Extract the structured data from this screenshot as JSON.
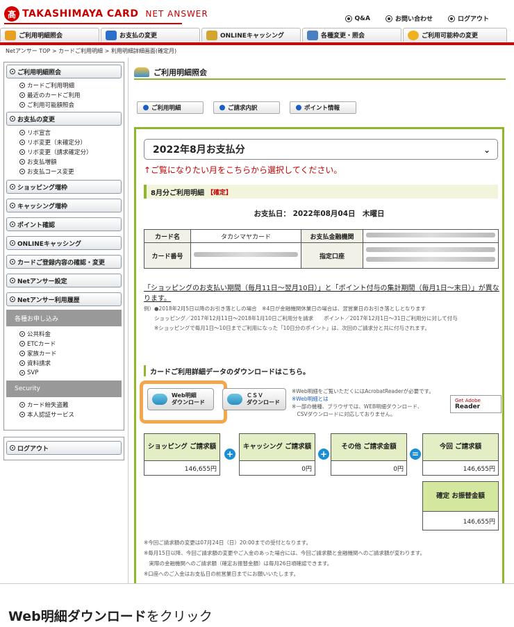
{
  "header": {
    "logo_mark": "髙",
    "logo_text": "TAKASHIMAYA CARD",
    "logo_sub": "NET ANSWER",
    "links": [
      "Q&A",
      "お問い合わせ",
      "ログアウト"
    ]
  },
  "tabs": [
    {
      "label": "ご利用明細照会",
      "color": "#e8a020"
    },
    {
      "label": "お支払の変更",
      "color": "#2c6fc8"
    },
    {
      "label": "ONLINEキャッシング",
      "color": "#d4a52e"
    },
    {
      "label": "各種変更・照会",
      "color": "#4a7fc0"
    },
    {
      "label": "ご利用可能枠の変更",
      "color": "#f0b020"
    }
  ],
  "breadcrumb": "Netアンサー TOP > カードご利用明細 > 利用明細詳細画面(確定月)",
  "sidebar": {
    "group1": {
      "label": "ご利用明細照会",
      "items": [
        "カードご利用明細",
        "最近のカードご利用",
        "ご利用可能額照会"
      ]
    },
    "group2": {
      "label": "お支払の変更",
      "items": [
        "リボ宣言",
        "リボ変更（未確定分）",
        "リボ変更（請求確定分）",
        "お支払増額",
        "お支払コース変更"
      ]
    },
    "buttons": [
      "ショッピング増枠",
      "キャッシング増枠",
      "ポイント確認",
      "ONLINEキャッシング",
      "カードご登録内容の確認・変更",
      "Netアンサー設定",
      "Netアンサー利用履歴"
    ],
    "section_apply": "各種お申し込み",
    "apply_items": [
      "公共料金",
      "ETCカード",
      "家族カード",
      "資料請求",
      "SVP"
    ],
    "section_security": "Security",
    "security_items": [
      "カード紛失盗難",
      "本人認証サービス"
    ],
    "logout": "ログアウト"
  },
  "main": {
    "title": "ご利用明細照会",
    "subtabs": [
      "ご利用明細",
      "ご請求内訳",
      "ポイント情報"
    ],
    "month_select": "2022年8月お支払分",
    "hint": "↑ご覧になりたい月をこちらから選択してください。",
    "section_title": "8月分ご利用明細",
    "section_status": "【確定】",
    "pay_date": "お支払日：  2022年08月04日　木曜日",
    "info": {
      "card_name_label": "カード名",
      "card_name": "タカシマヤカード",
      "bank_label": "お支払金融機関",
      "card_no_label": "カード番号",
      "account_label": "指定口座"
    },
    "notice": "「ショッピングのお支払い期間（毎月11日～翌月10日）」と「ポイント付与の集計期間（毎月1日～末日）」が異なります。",
    "notice_small": [
      "例）●2018年2月5日以降のお引き落としの場合　※4日が金融機関休業日の場合は、翌営業日のお引き落としとなります",
      "　　ショッピング／2017年12月11日～2018年1月10日ご利用分を請求　　ポイント／2017年12月1日～31日ご利用分に対して付与",
      "　　※ショッピングで毎月1日～10日までご利用になった「10日分のポイント」は、次回のご請求分と共に付与されます。"
    ],
    "download_head": "カードご利用詳細データのダウンロードはこちら。",
    "web_btn": [
      "Web明細",
      "ダウンロード"
    ],
    "csv_btn": [
      "ＣＳＶ",
      "ダウンロード"
    ],
    "download_notes": [
      "※Web明細をご覧いただくにはAcrobatReaderが必要です。",
      "※Web明細とは",
      "※一部の機種、ブラウザでは、WEB明細ダウンロード、",
      "　CSVダウンロードに対応しておりません。"
    ],
    "adobe": [
      "Get Adobe",
      "Reader"
    ],
    "summary": [
      {
        "title": "ショッピング ご請求額",
        "value": "146,655円"
      },
      {
        "title": "キャッシング ご請求額",
        "value": "0円"
      },
      {
        "title": "その他 ご請求金額",
        "value": "0円"
      },
      {
        "title": "今回 ご請求額",
        "value": "146,655円"
      }
    ],
    "operators": [
      "+",
      "+",
      "="
    ],
    "final": {
      "title": "確定 お振替金額",
      "value": "146,655円"
    },
    "footnotes": [
      "※今回ご請求額の変更は07月24日（日）20:00までの受付となります。",
      "※毎月15日以降、今回ご請求額の変更やご入金のあった場合には、今回ご請求額と金融機関へのご請求額が変わります。",
      "　実際の金融機関へのご請求額（確定お振替金額）は毎月26日頃確認できます。",
      "※口座へのご入金はお支払日の前営業日までにお願いいたします。"
    ]
  },
  "caption": {
    "bold": "Web明細ダウンロード",
    "rest": "をクリック"
  }
}
